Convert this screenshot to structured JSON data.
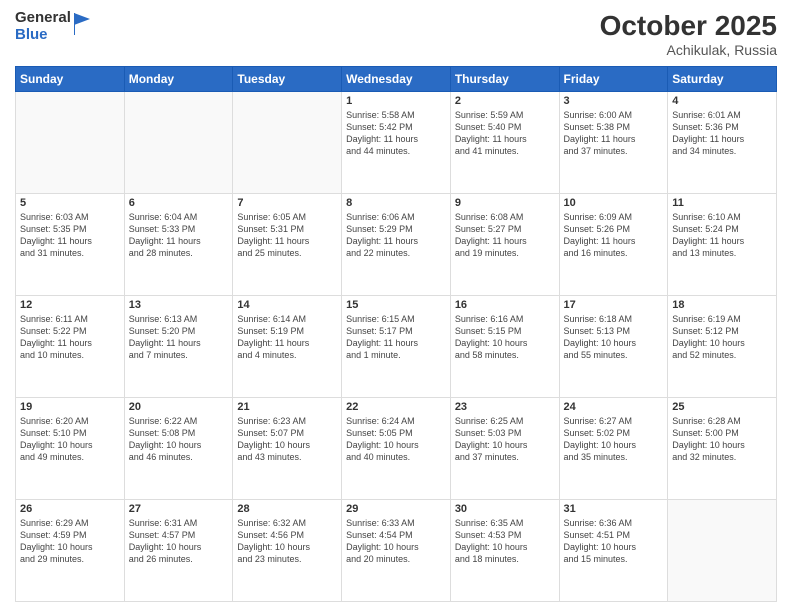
{
  "logo": {
    "general": "General",
    "blue": "Blue"
  },
  "title": "October 2025",
  "location": "Achikulak, Russia",
  "days_of_week": [
    "Sunday",
    "Monday",
    "Tuesday",
    "Wednesday",
    "Thursday",
    "Friday",
    "Saturday"
  ],
  "weeks": [
    [
      {
        "num": "",
        "info": ""
      },
      {
        "num": "",
        "info": ""
      },
      {
        "num": "",
        "info": ""
      },
      {
        "num": "1",
        "info": "Sunrise: 5:58 AM\nSunset: 5:42 PM\nDaylight: 11 hours\nand 44 minutes."
      },
      {
        "num": "2",
        "info": "Sunrise: 5:59 AM\nSunset: 5:40 PM\nDaylight: 11 hours\nand 41 minutes."
      },
      {
        "num": "3",
        "info": "Sunrise: 6:00 AM\nSunset: 5:38 PM\nDaylight: 11 hours\nand 37 minutes."
      },
      {
        "num": "4",
        "info": "Sunrise: 6:01 AM\nSunset: 5:36 PM\nDaylight: 11 hours\nand 34 minutes."
      }
    ],
    [
      {
        "num": "5",
        "info": "Sunrise: 6:03 AM\nSunset: 5:35 PM\nDaylight: 11 hours\nand 31 minutes."
      },
      {
        "num": "6",
        "info": "Sunrise: 6:04 AM\nSunset: 5:33 PM\nDaylight: 11 hours\nand 28 minutes."
      },
      {
        "num": "7",
        "info": "Sunrise: 6:05 AM\nSunset: 5:31 PM\nDaylight: 11 hours\nand 25 minutes."
      },
      {
        "num": "8",
        "info": "Sunrise: 6:06 AM\nSunset: 5:29 PM\nDaylight: 11 hours\nand 22 minutes."
      },
      {
        "num": "9",
        "info": "Sunrise: 6:08 AM\nSunset: 5:27 PM\nDaylight: 11 hours\nand 19 minutes."
      },
      {
        "num": "10",
        "info": "Sunrise: 6:09 AM\nSunset: 5:26 PM\nDaylight: 11 hours\nand 16 minutes."
      },
      {
        "num": "11",
        "info": "Sunrise: 6:10 AM\nSunset: 5:24 PM\nDaylight: 11 hours\nand 13 minutes."
      }
    ],
    [
      {
        "num": "12",
        "info": "Sunrise: 6:11 AM\nSunset: 5:22 PM\nDaylight: 11 hours\nand 10 minutes."
      },
      {
        "num": "13",
        "info": "Sunrise: 6:13 AM\nSunset: 5:20 PM\nDaylight: 11 hours\nand 7 minutes."
      },
      {
        "num": "14",
        "info": "Sunrise: 6:14 AM\nSunset: 5:19 PM\nDaylight: 11 hours\nand 4 minutes."
      },
      {
        "num": "15",
        "info": "Sunrise: 6:15 AM\nSunset: 5:17 PM\nDaylight: 11 hours\nand 1 minute."
      },
      {
        "num": "16",
        "info": "Sunrise: 6:16 AM\nSunset: 5:15 PM\nDaylight: 10 hours\nand 58 minutes."
      },
      {
        "num": "17",
        "info": "Sunrise: 6:18 AM\nSunset: 5:13 PM\nDaylight: 10 hours\nand 55 minutes."
      },
      {
        "num": "18",
        "info": "Sunrise: 6:19 AM\nSunset: 5:12 PM\nDaylight: 10 hours\nand 52 minutes."
      }
    ],
    [
      {
        "num": "19",
        "info": "Sunrise: 6:20 AM\nSunset: 5:10 PM\nDaylight: 10 hours\nand 49 minutes."
      },
      {
        "num": "20",
        "info": "Sunrise: 6:22 AM\nSunset: 5:08 PM\nDaylight: 10 hours\nand 46 minutes."
      },
      {
        "num": "21",
        "info": "Sunrise: 6:23 AM\nSunset: 5:07 PM\nDaylight: 10 hours\nand 43 minutes."
      },
      {
        "num": "22",
        "info": "Sunrise: 6:24 AM\nSunset: 5:05 PM\nDaylight: 10 hours\nand 40 minutes."
      },
      {
        "num": "23",
        "info": "Sunrise: 6:25 AM\nSunset: 5:03 PM\nDaylight: 10 hours\nand 37 minutes."
      },
      {
        "num": "24",
        "info": "Sunrise: 6:27 AM\nSunset: 5:02 PM\nDaylight: 10 hours\nand 35 minutes."
      },
      {
        "num": "25",
        "info": "Sunrise: 6:28 AM\nSunset: 5:00 PM\nDaylight: 10 hours\nand 32 minutes."
      }
    ],
    [
      {
        "num": "26",
        "info": "Sunrise: 6:29 AM\nSunset: 4:59 PM\nDaylight: 10 hours\nand 29 minutes."
      },
      {
        "num": "27",
        "info": "Sunrise: 6:31 AM\nSunset: 4:57 PM\nDaylight: 10 hours\nand 26 minutes."
      },
      {
        "num": "28",
        "info": "Sunrise: 6:32 AM\nSunset: 4:56 PM\nDaylight: 10 hours\nand 23 minutes."
      },
      {
        "num": "29",
        "info": "Sunrise: 6:33 AM\nSunset: 4:54 PM\nDaylight: 10 hours\nand 20 minutes."
      },
      {
        "num": "30",
        "info": "Sunrise: 6:35 AM\nSunset: 4:53 PM\nDaylight: 10 hours\nand 18 minutes."
      },
      {
        "num": "31",
        "info": "Sunrise: 6:36 AM\nSunset: 4:51 PM\nDaylight: 10 hours\nand 15 minutes."
      },
      {
        "num": "",
        "info": ""
      }
    ]
  ]
}
